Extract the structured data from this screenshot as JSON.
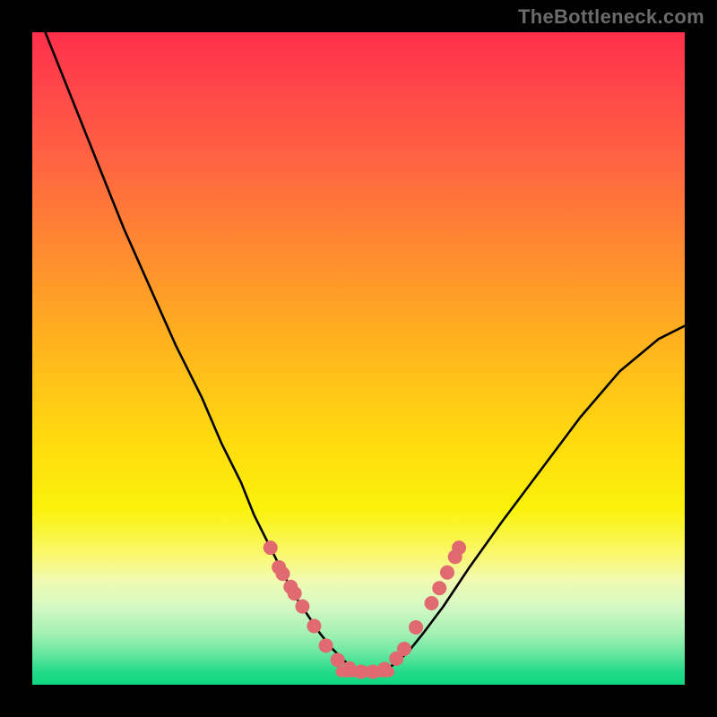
{
  "watermark": "TheBottleneck.com",
  "chart_data": {
    "type": "line",
    "title": "",
    "xlabel": "",
    "ylabel": "",
    "xlim": [
      0,
      100
    ],
    "ylim": [
      0,
      100
    ],
    "series": [
      {
        "name": "bottleneck-curve",
        "x": [
          2,
          6,
          10,
          14,
          18,
          22,
          26,
          29,
          32,
          34,
          36,
          38,
          40,
          42,
          44,
          46,
          48,
          50,
          52,
          54,
          56,
          58,
          60,
          63,
          67,
          72,
          78,
          84,
          90,
          96,
          100
        ],
        "values": [
          100,
          90,
          80,
          70,
          61,
          52,
          44,
          37,
          31,
          26,
          22,
          18,
          14,
          11,
          8,
          5.5,
          3.5,
          2.2,
          2,
          2.2,
          3.5,
          5.5,
          8,
          12,
          18,
          25,
          33,
          41,
          48,
          53,
          55
        ]
      }
    ],
    "markers": {
      "name": "benchmark-points",
      "x": [
        36.5,
        37.8,
        38.4,
        39.6,
        40.2,
        41.4,
        43.2,
        45.0,
        46.8,
        48.6,
        50.4,
        52.2,
        54.0,
        55.8,
        57.0,
        58.8,
        61.2,
        62.4,
        63.6,
        64.8,
        65.4
      ],
      "values": [
        21.0,
        18.0,
        17.0,
        15.0,
        14.0,
        12.0,
        9.0,
        6.0,
        3.8,
        2.5,
        2.0,
        2.0,
        2.4,
        4.0,
        5.5,
        8.8,
        12.5,
        14.8,
        17.2,
        19.6,
        21.0
      ],
      "color": "#e06a6f",
      "radius": 8
    },
    "minimum_segment": {
      "x_start": 46.5,
      "x_end": 55.5,
      "y": 2,
      "color": "#e06a6f",
      "height": 12
    }
  }
}
